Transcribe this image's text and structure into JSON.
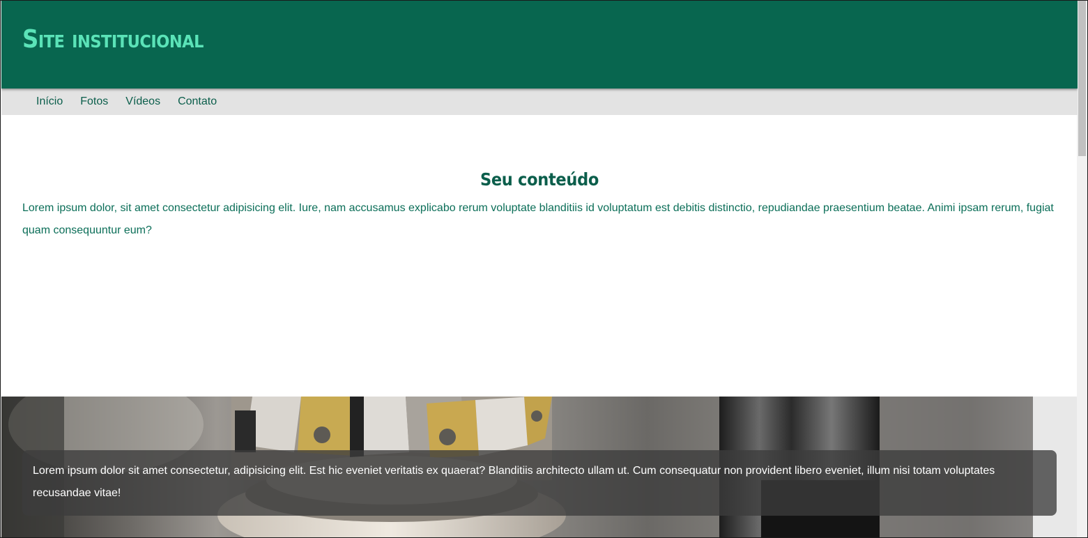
{
  "site": {
    "title": "Site institucional"
  },
  "nav": {
    "items": [
      {
        "label": "Início"
      },
      {
        "label": "Fotos"
      },
      {
        "label": "Vídeos"
      },
      {
        "label": "Contato"
      }
    ]
  },
  "content": {
    "title": "Seu conteúdo",
    "text": "Lorem ipsum dolor, sit amet consectetur adipisicing elit. Iure, nam accusamus explicabo rerum voluptate blanditiis id voluptatum est debitis distinctio, repudiandae praesentium beatae. Animi ipsam rerum, fugiat quam consequuntur eum?"
  },
  "banner": {
    "caption": "Lorem ipsum dolor sit amet consectetur, adipisicing elit. Est hic eveniet veritatis ex quaerat? Blanditiis architecto ullam ut. Cum consequatur non provident libero eveniet, illum nisi totam voluptates recusandae vitae!",
    "image_subject": "industrial-milling-cutter-photo"
  },
  "colors": {
    "header_bg": "#08664f",
    "title_color": "#5be3b8",
    "nav_bg": "#e3e3e3",
    "text_green": "#0b5e4b"
  }
}
